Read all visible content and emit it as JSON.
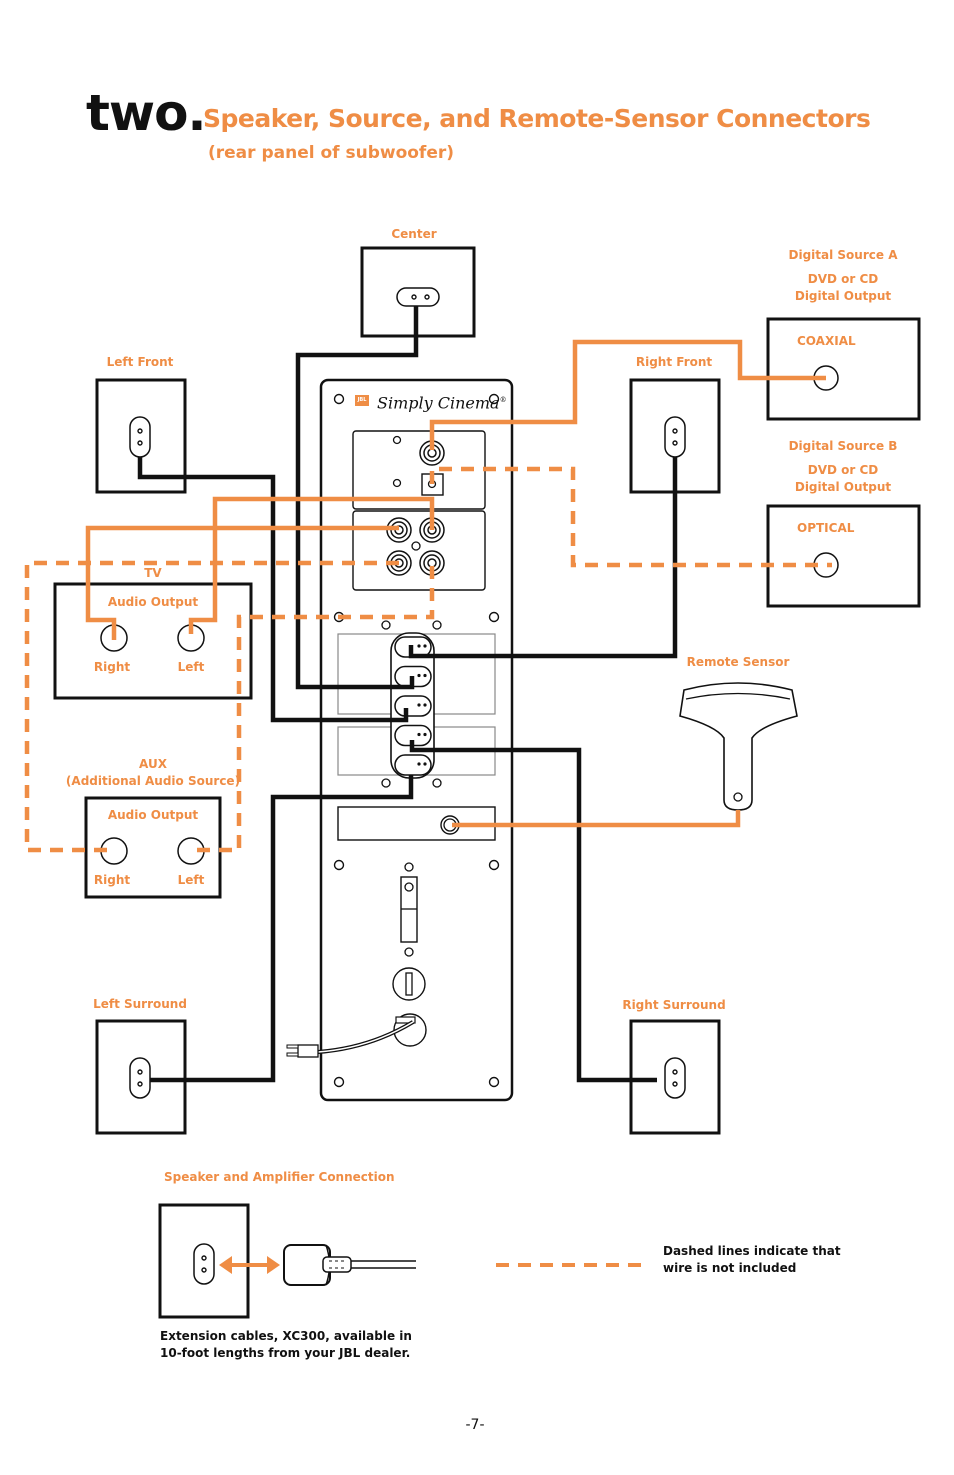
{
  "header": {
    "section_word": "two.",
    "title": "Speaker, Source, and Remote-Sensor Connectors",
    "subtitle": "(rear panel of subwoofer)"
  },
  "colors": {
    "accent": "#EF8D45",
    "ink": "#111111"
  },
  "subwoofer_panel": {
    "brand_badge": "JBL",
    "brand_name": "Simply Cinema",
    "registered_mark": "®",
    "speaker_output_count": 5
  },
  "speakers": {
    "center": "Center",
    "left_front": "Left Front",
    "right_front": "Right Front",
    "left_surround": "Left Surround",
    "right_surround": "Right Surround"
  },
  "sources": {
    "digital_a": {
      "title": "Digital Source A",
      "line1": "DVD or CD",
      "line2": "Digital Output",
      "connector": "COAXIAL"
    },
    "digital_b": {
      "title": "Digital Source B",
      "line1": "DVD or CD",
      "line2": "Digital Output",
      "connector": "OPTICAL"
    },
    "tv": {
      "title": "TV",
      "output_label": "Audio Output",
      "right": "Right",
      "left": "Left"
    },
    "aux": {
      "title": "AUX",
      "subtitle": "(Additional Audio Source)",
      "output_label": "Audio Output",
      "right": "Right",
      "left": "Left"
    }
  },
  "remote_sensor": {
    "label": "Remote Sensor"
  },
  "legend": {
    "speaker_amp_title": "Speaker and Amplifier Connection",
    "extension_note_line1": "Extension cables, XC300, available in",
    "extension_note_line2": "10-foot lengths from your JBL dealer.",
    "dashed_note_line1": "Dashed lines indicate that",
    "dashed_note_line2": "wire is not included"
  },
  "footer": {
    "page_number": "-7-"
  }
}
